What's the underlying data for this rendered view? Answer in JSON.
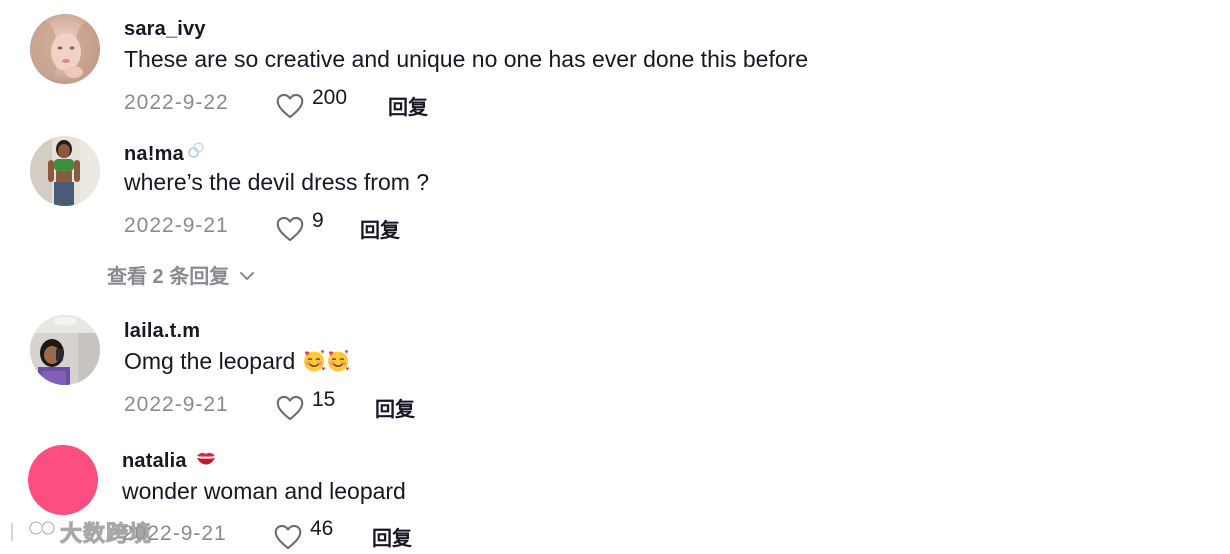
{
  "colors": {
    "primary_text": "#161823",
    "secondary_text": "#8a8b91",
    "background": "#ffffff",
    "natalia_avatar": "#fe2c55"
  },
  "comments": [
    {
      "username": "sara_ivy",
      "text": "These are so creative and unique no one has ever done this before",
      "date": "2022-9-22",
      "likes": "200",
      "reply_label": "回复",
      "avatar": "user-photo-sara"
    },
    {
      "username": "na!ma",
      "username_badge": "gender-symbol-icon",
      "text": "where’s the devil dress from ?",
      "date": "2022-9-21",
      "likes": "9",
      "reply_label": "回复",
      "avatar": "user-photo-nama",
      "view_replies_label": "查看 2 条回复"
    },
    {
      "username": "laila.t.m",
      "text": "Omg the leopard",
      "text_emojis": [
        "smiling-face-with-hearts",
        "smiling-face-with-hearts"
      ],
      "date": "2022-9-21",
      "likes": "15",
      "reply_label": "回复",
      "avatar": "user-photo-laila"
    },
    {
      "username": "natalia",
      "username_badge": "kiss-mark-emoji",
      "text": "wonder woman and leopard",
      "date": "2022-9-21",
      "likes": "46",
      "reply_label": "回复",
      "avatar": "solid-pink-circle"
    }
  ],
  "watermark": {
    "text": "大数跨境",
    "icon": "logo-icon"
  }
}
